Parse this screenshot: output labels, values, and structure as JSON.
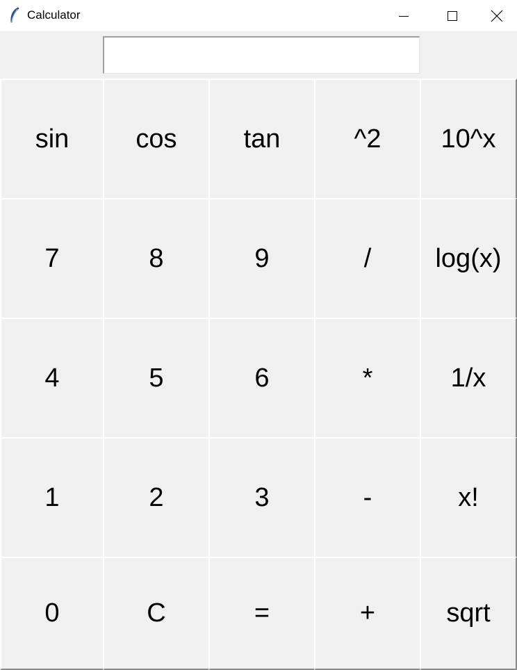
{
  "window": {
    "title": "Calculator",
    "app_icon": "feather-icon"
  },
  "display": {
    "value": ""
  },
  "keys": [
    [
      "sin",
      "cos",
      "tan",
      "^2",
      "10^x"
    ],
    [
      "7",
      "8",
      "9",
      "/",
      "log(x)"
    ],
    [
      "4",
      "5",
      "6",
      "*",
      "1/x"
    ],
    [
      "1",
      "2",
      "3",
      "-",
      "x!"
    ],
    [
      "0",
      "C",
      "=",
      "+",
      "sqrt"
    ]
  ],
  "key_names": [
    [
      "sin-button",
      "cos-button",
      "tan-button",
      "square-button",
      "ten-power-button"
    ],
    [
      "digit-7-button",
      "digit-8-button",
      "digit-9-button",
      "divide-button",
      "log-button"
    ],
    [
      "digit-4-button",
      "digit-5-button",
      "digit-6-button",
      "multiply-button",
      "reciprocal-button"
    ],
    [
      "digit-1-button",
      "digit-2-button",
      "digit-3-button",
      "subtract-button",
      "factorial-button"
    ],
    [
      "digit-0-button",
      "clear-button",
      "equals-button",
      "add-button",
      "sqrt-button"
    ]
  ]
}
